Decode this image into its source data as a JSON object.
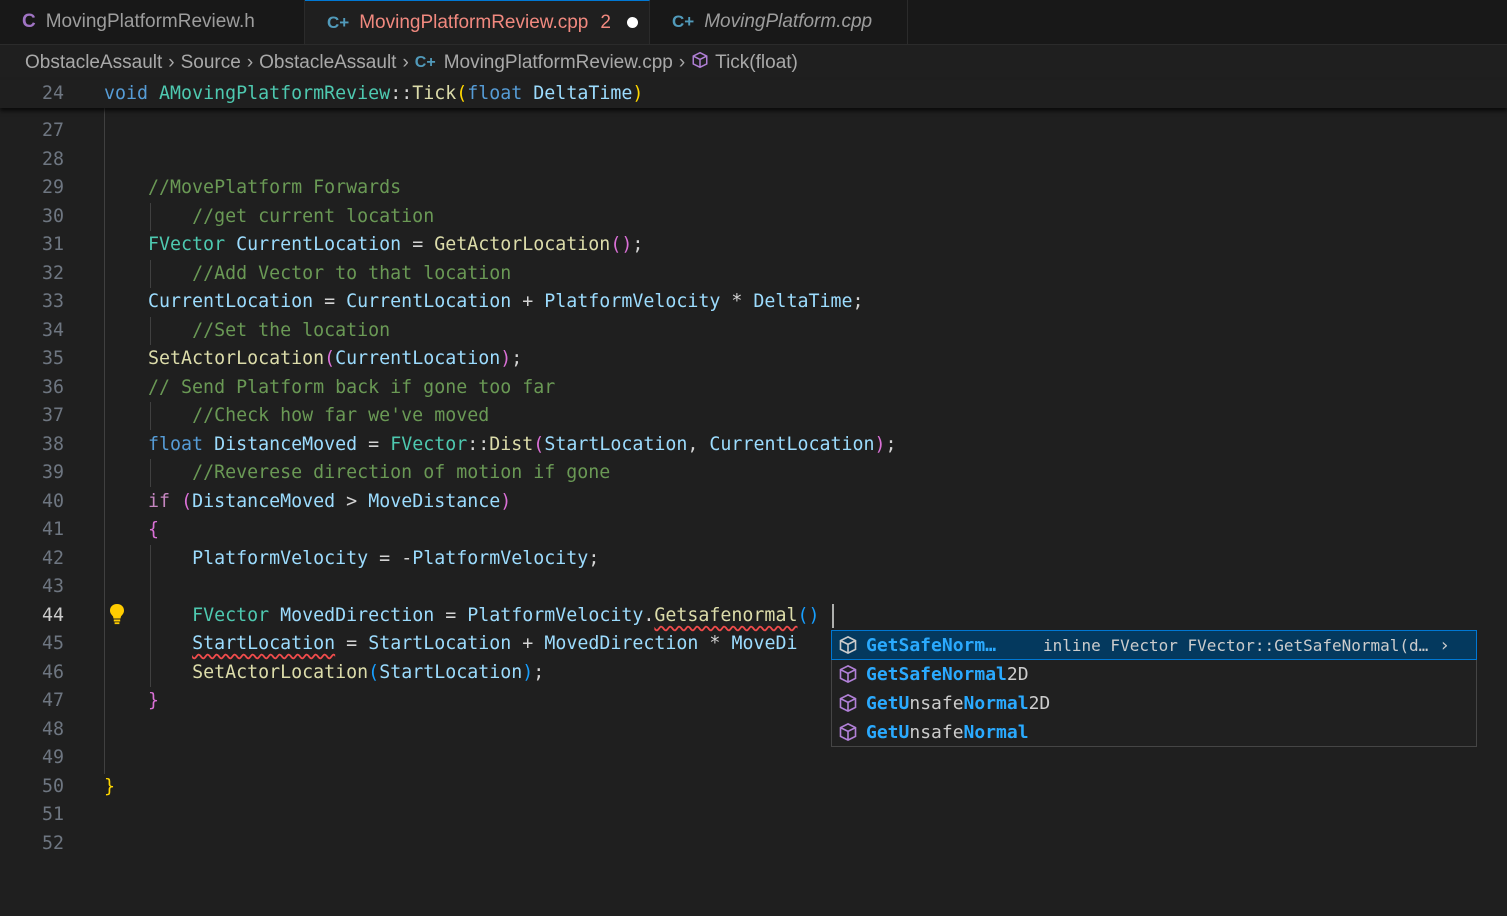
{
  "tabs": [
    {
      "icon": "C",
      "label": "MovingPlatformReview.h",
      "active": false
    },
    {
      "icon": "C+",
      "label": "MovingPlatformReview.cpp",
      "problems": "2",
      "active": true,
      "dirty": true
    },
    {
      "icon": "C+",
      "label": "MovingPlatform.cpp",
      "active": false,
      "preview": true
    }
  ],
  "breadcrumb": [
    "ObstacleAssault",
    "Source",
    "ObstacleAssault",
    "MovingPlatformReview.cpp",
    "Tick(float)"
  ],
  "sticky": {
    "line": "24",
    "text": "void AMovingPlatformReview::Tick(float DeltaTime)"
  },
  "line_numbers": [
    "27",
    "28",
    "29",
    "30",
    "31",
    "32",
    "33",
    "34",
    "35",
    "36",
    "37",
    "38",
    "39",
    "40",
    "41",
    "42",
    "43",
    "44",
    "45",
    "46",
    "47",
    "48",
    "49",
    "50",
    "51",
    "52"
  ],
  "current_line": "44",
  "suggest": {
    "items": [
      {
        "match": "GetSafeNorm…",
        "rest": "",
        "detail": "inline FVector FVector::GetSafeNormal(d…"
      },
      {
        "match": "GetSafeNormal",
        "rest": "2D"
      },
      {
        "match": "GetU",
        "rest": "nsafe",
        "match2": "Normal",
        "rest2": "2D"
      },
      {
        "match": "GetU",
        "rest": "nsafe",
        "match2": "Normal",
        "rest2": ""
      }
    ],
    "more": "›"
  },
  "colors": {
    "keyword": "#569cd6",
    "type": "#4ec9b0",
    "function": "#dcdcaa",
    "variable": "#9cdcfe",
    "comment": "#6a9955",
    "control": "#c586c0",
    "accent": "#0078d4"
  }
}
